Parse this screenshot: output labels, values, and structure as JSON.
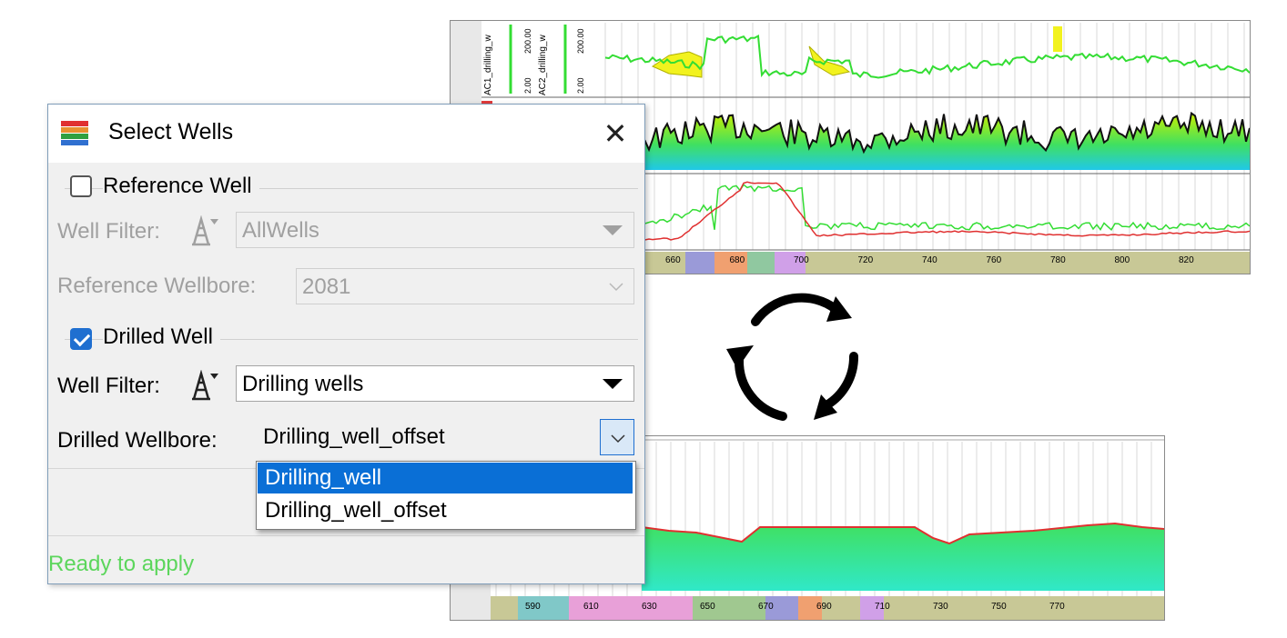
{
  "dialog": {
    "title": "Select Wells",
    "reference_group": {
      "label": "Reference Well",
      "checked": false,
      "well_filter_label": "Well Filter:",
      "well_filter_value": "AllWells",
      "wellbore_label": "Reference Wellbore:",
      "wellbore_value": "2081"
    },
    "drilled_group": {
      "label": "Drilled Well",
      "checked": true,
      "well_filter_label": "Well Filter:",
      "well_filter_value": "Drilling wells",
      "wellbore_label": "Drilled Wellbore:",
      "wellbore_value": "Drilling_well_offset",
      "options": [
        "Drilling_well",
        "Drilling_well_offset"
      ],
      "highlighted": "Drilling_well"
    },
    "status": "Ready to apply"
  },
  "log_top": {
    "track_labels": [
      "AC1_drilling_w",
      "AC2_drilling_w"
    ],
    "scale_min": "2.00",
    "scale_max": "200.00",
    "depth_ticks": [
      "660",
      "680",
      "700",
      "720",
      "740",
      "760",
      "780",
      "800",
      "820"
    ]
  },
  "log_bottom": {
    "depth_ticks": [
      "590",
      "610",
      "630",
      "650",
      "670",
      "690",
      "710",
      "730",
      "750",
      "770"
    ]
  },
  "colors": {
    "accent": "#0a6fd6",
    "status": "#5cd65c",
    "curve_green": "#33dd33",
    "curve_red": "#e03030"
  }
}
